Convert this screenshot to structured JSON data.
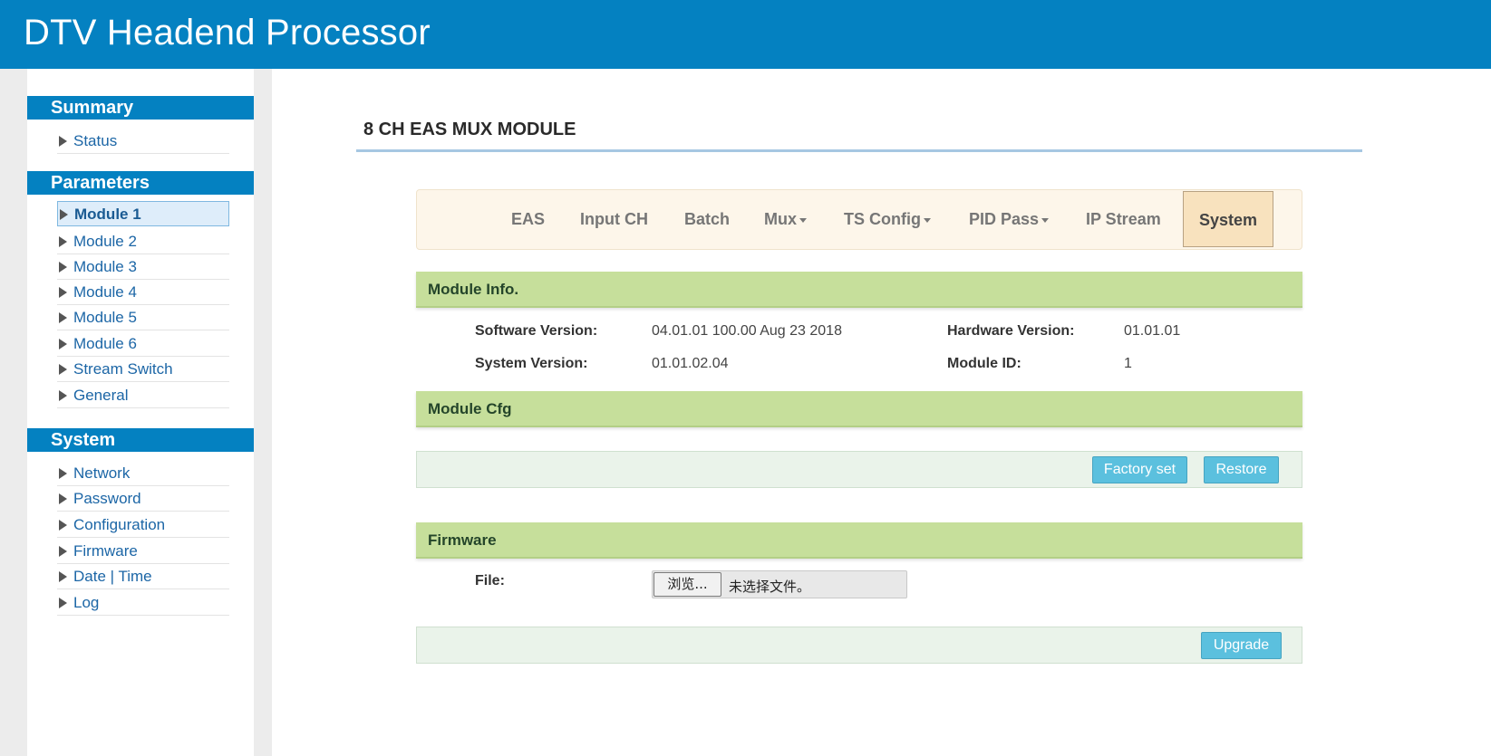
{
  "header": {
    "title": "DTV Headend Processor"
  },
  "sidebar": {
    "summary": {
      "heading": "Summary",
      "items": [
        {
          "label": "Status"
        }
      ]
    },
    "parameters": {
      "heading": "Parameters",
      "items": [
        {
          "label": "Module 1",
          "active": true
        },
        {
          "label": "Module 2"
        },
        {
          "label": "Module 3"
        },
        {
          "label": "Module 4"
        },
        {
          "label": "Module 5"
        },
        {
          "label": "Module 6"
        },
        {
          "label": "Stream Switch"
        },
        {
          "label": "General"
        }
      ]
    },
    "system": {
      "heading": "System",
      "items": [
        {
          "label": "Network"
        },
        {
          "label": "Password"
        },
        {
          "label": "Configuration"
        },
        {
          "label": "Firmware"
        },
        {
          "label": "Date | Time"
        },
        {
          "label": "Log"
        }
      ]
    }
  },
  "main": {
    "page_title": "8 CH EAS MUX MODULE",
    "tabs": [
      {
        "label": "EAS"
      },
      {
        "label": "Input CH"
      },
      {
        "label": "Batch"
      },
      {
        "label": "Mux",
        "dropdown": true
      },
      {
        "label": "TS Config",
        "dropdown": true
      },
      {
        "label": "PID Pass",
        "dropdown": true
      },
      {
        "label": "IP Stream"
      },
      {
        "label": "System",
        "active": true
      }
    ],
    "module_info": {
      "heading": "Module Info.",
      "software_version_label": "Software Version:",
      "software_version": "04.01.01 100.00 Aug 23 2018",
      "hardware_version_label": "Hardware Version:",
      "hardware_version": "01.01.01",
      "system_version_label": "System Version:",
      "system_version": "01.01.02.04",
      "module_id_label": "Module ID:",
      "module_id": "1"
    },
    "module_cfg": {
      "heading": "Module Cfg",
      "factory_set_label": "Factory set",
      "restore_label": "Restore"
    },
    "firmware": {
      "heading": "Firmware",
      "file_label": "File:",
      "browse_label": "浏览...",
      "no_file_text": "未选择文件。",
      "upgrade_label": "Upgrade"
    }
  },
  "colors": {
    "header_bg": "#0481c1",
    "section_bar": "#c6df9b",
    "button": "#5bc0de",
    "active_tab": "#f8e2be",
    "link": "#1c66a6"
  },
  "icons": {
    "sidebar_bullet": "triangle-right-icon",
    "tab_dropdown": "caret-down-icon"
  }
}
